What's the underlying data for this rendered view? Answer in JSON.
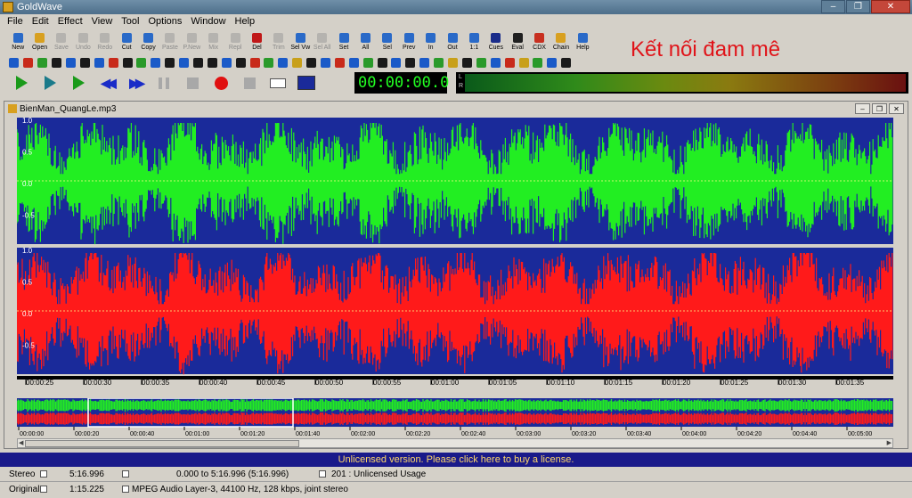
{
  "app": {
    "title": "GoldWave"
  },
  "menu": [
    "File",
    "Edit",
    "Effect",
    "View",
    "Tool",
    "Options",
    "Window",
    "Help"
  ],
  "toolbar": [
    {
      "label": "New",
      "icon": "new-doc-icon",
      "color": "#2a6ac8",
      "enabled": true
    },
    {
      "label": "Open",
      "icon": "open-folder-icon",
      "color": "#d8a020",
      "enabled": true
    },
    {
      "label": "Save",
      "icon": "save-icon",
      "color": "#909090",
      "enabled": false
    },
    {
      "label": "Undo",
      "icon": "undo-icon",
      "color": "#909090",
      "enabled": false
    },
    {
      "label": "Redo",
      "icon": "redo-icon",
      "color": "#909090",
      "enabled": false
    },
    {
      "label": "Cut",
      "icon": "scissors-icon",
      "color": "#2a6ac8",
      "enabled": true
    },
    {
      "label": "Copy",
      "icon": "copy-icon",
      "color": "#2a6ac8",
      "enabled": true
    },
    {
      "label": "Paste",
      "icon": "paste-icon",
      "color": "#909090",
      "enabled": false
    },
    {
      "label": "P.New",
      "icon": "paste-new-icon",
      "color": "#909090",
      "enabled": false
    },
    {
      "label": "Mix",
      "icon": "mix-icon",
      "color": "#909090",
      "enabled": false
    },
    {
      "label": "Repl",
      "icon": "replace-icon",
      "color": "#909090",
      "enabled": false
    },
    {
      "label": "Del",
      "icon": "delete-icon",
      "color": "#c01818",
      "enabled": true
    },
    {
      "label": "Trim",
      "icon": "trim-icon",
      "color": "#909090",
      "enabled": false
    },
    {
      "label": "Sel Vw",
      "icon": "select-view-icon",
      "color": "#2a6ac8",
      "enabled": true
    },
    {
      "label": "Sel All",
      "icon": "select-all-icon",
      "color": "#909090",
      "enabled": false
    },
    {
      "label": "Set",
      "icon": "set-icon",
      "color": "#2a6ac8",
      "enabled": true
    },
    {
      "label": "All",
      "icon": "zoom-all-icon",
      "color": "#2a6ac8",
      "enabled": true
    },
    {
      "label": "Sel",
      "icon": "zoom-sel-icon",
      "color": "#2a6ac8",
      "enabled": true
    },
    {
      "label": "Prev",
      "icon": "zoom-prev-icon",
      "color": "#2a6ac8",
      "enabled": true
    },
    {
      "label": "In",
      "icon": "zoom-in-icon",
      "color": "#2a6ac8",
      "enabled": true
    },
    {
      "label": "Out",
      "icon": "zoom-out-icon",
      "color": "#2a6ac8",
      "enabled": true
    },
    {
      "label": "1:1",
      "icon": "zoom-1-1-icon",
      "color": "#2a6ac8",
      "enabled": true
    },
    {
      "label": "Cues",
      "icon": "cues-icon",
      "color": "#1a2c8a",
      "enabled": true
    },
    {
      "label": "Eval",
      "icon": "eval-icon",
      "color": "#202020",
      "enabled": true
    },
    {
      "label": "CDX",
      "icon": "cd-icon",
      "color": "#c83020",
      "enabled": true
    },
    {
      "label": "Chain",
      "icon": "chain-icon",
      "color": "#d8a020",
      "enabled": true
    },
    {
      "label": "Help",
      "icon": "help-icon",
      "color": "#2a6ac8",
      "enabled": true
    }
  ],
  "brand_text": "Kết nối đam mê",
  "transport": {
    "buttons": [
      "play-all-icon",
      "play-selection-icon",
      "play-from-cursor-icon",
      "rewind-icon",
      "fast-forward-icon",
      "pause-icon",
      "stop-icon",
      "record-icon",
      "stop-record-icon",
      "monitor-checkbox-icon",
      "control-properties-icon"
    ],
    "time": "00:00:00.0",
    "meter_labels": "L\nR"
  },
  "document": {
    "title": "BienMan_QuangLe.mp3",
    "channels": [
      {
        "name": "left",
        "color": "#22ee22"
      },
      {
        "name": "right",
        "color": "#ff1a1a"
      }
    ],
    "amp_ticks": [
      "1.0",
      "0.5",
      "0.0",
      "-0.5"
    ],
    "timeline": [
      "00:00:25",
      "00:00:30",
      "00:00:35",
      "00:00:40",
      "00:00:45",
      "00:00:50",
      "00:00:55",
      "00:01:00",
      "00:01:05",
      "00:01:10",
      "00:01:15",
      "00:01:20",
      "00:01:25",
      "00:01:30",
      "00:01:35"
    ],
    "overview_timeline": [
      "00:00:00",
      "00:00:20",
      "00:00:40",
      "00:01:00",
      "00:01:20",
      "00:01:40",
      "00:02:00",
      "00:02:20",
      "00:02:40",
      "00:03:00",
      "00:03:20",
      "00:03:40",
      "00:04:00",
      "00:04:20",
      "00:04:40",
      "00:05:00"
    ],
    "wave_background": "#1a2a9a"
  },
  "status": {
    "license": "Unlicensed version. Please click here to buy a license.",
    "channels": "Stereo",
    "length": "5:16.996",
    "selection": "0.000 to 5:16.996 (5:16.996)",
    "usage": "201 : Unlicensed Usage",
    "mode": "Original",
    "position": "1:15.225",
    "format": "MPEG Audio Layer-3, 44100 Hz, 128 kbps, joint stereo"
  }
}
